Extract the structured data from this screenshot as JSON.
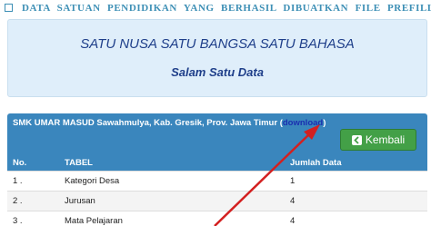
{
  "topbar": {
    "text": "DATA SATUAN PENDIDIKAN YANG BERHASIL DIBUATKAN FILE PREFILL"
  },
  "hero": {
    "title": "SATU NUSA SATU BANGSA SATU BAHASA",
    "subtitle": "Salam Satu Data"
  },
  "panel": {
    "school": "SMK UMAR MASUD Sawahmulya, Kab. Gresik, Prov. Jawa Timur (",
    "download_link": "download",
    "close_paren": ")",
    "back_button": "Kembali"
  },
  "table": {
    "headers": [
      "No.",
      "TABEL",
      "Jumlah Data"
    ],
    "rows": [
      {
        "no": "1 .",
        "tabel": "Kategori Desa",
        "jumlah": "1"
      },
      {
        "no": "2 .",
        "tabel": "Jurusan",
        "jumlah": "4"
      },
      {
        "no": "3 .",
        "tabel": "Mata Pelajaran",
        "jumlah": "4"
      }
    ]
  },
  "colors": {
    "header_blue": "#3a86bd",
    "hero_bg": "#dfeefa",
    "button_green": "#43a047",
    "arrow_red": "#d32020"
  }
}
